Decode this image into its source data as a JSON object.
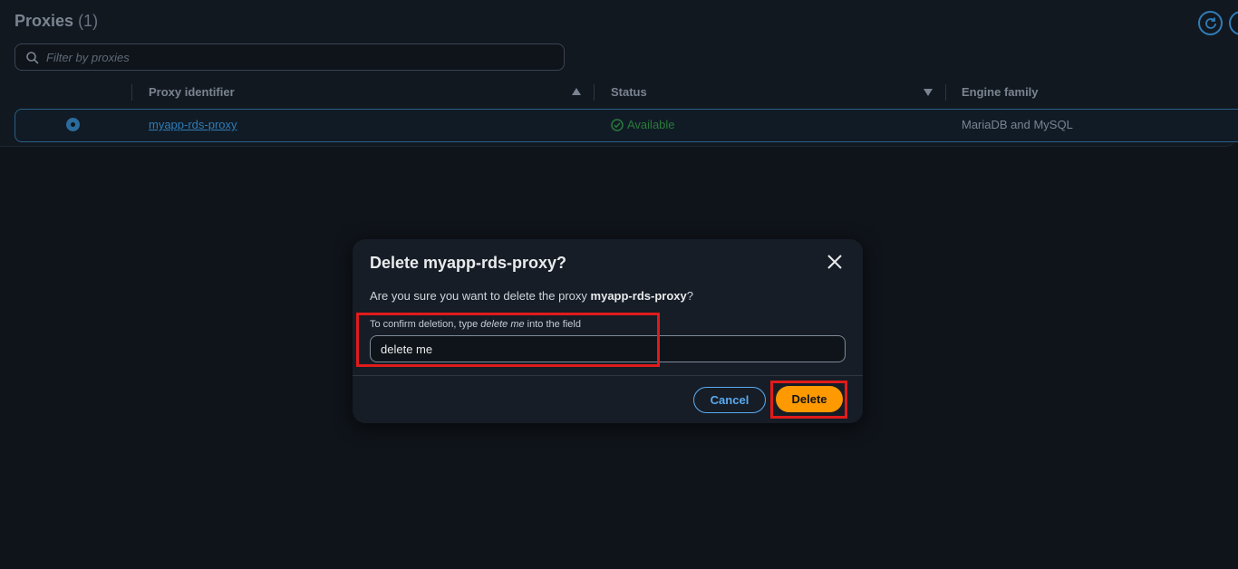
{
  "page": {
    "title": "Proxies",
    "count": "(1)",
    "filter_placeholder": "Filter by proxies",
    "columns": [
      "Proxy identifier",
      "Status",
      "Engine family"
    ],
    "rows": [
      {
        "identifier": "myapp-rds-proxy",
        "status": "Available",
        "engine": "MariaDB and MySQL",
        "selected": true
      }
    ]
  },
  "modal": {
    "title": "Delete myapp-rds-proxy?",
    "message_prefix": "Are you sure you want to delete the proxy ",
    "message_name": "myapp-rds-proxy",
    "message_suffix": "?",
    "confirm_prefix": "To confirm deletion, type ",
    "confirm_phrase": "delete me",
    "confirm_suffix": " into the field",
    "input_value": "delete me",
    "cancel_label": "Cancel",
    "delete_label": "Delete"
  },
  "colors": {
    "accent": "#5aaaf0",
    "primary_button": "#ff9900",
    "status_available": "#2a7a3a",
    "annotation": "#e01b1b"
  },
  "icons": [
    "refresh-icon",
    "search-icon",
    "sort-ascending-icon",
    "sort-descending-icon",
    "check-circle-icon",
    "close-icon"
  ]
}
